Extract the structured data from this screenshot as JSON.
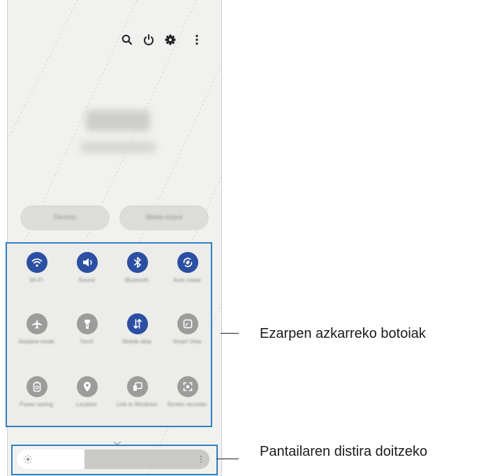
{
  "phone": {
    "top_icons": [
      "search-icon",
      "power-icon",
      "settings-icon",
      "more-vertical-icon"
    ],
    "quick_settings": [
      {
        "label": "Wi-Fi",
        "icon": "wifi-icon",
        "active": true
      },
      {
        "label": "Sound",
        "icon": "sound-icon",
        "active": true
      },
      {
        "label": "Bluetooth",
        "icon": "bluetooth-icon",
        "active": true
      },
      {
        "label": "Auto rotate",
        "icon": "auto-rotate-icon",
        "active": true
      },
      {
        "label": "Airplane mode",
        "icon": "airplane-icon",
        "active": false
      },
      {
        "label": "Torch",
        "icon": "flashlight-icon",
        "active": false
      },
      {
        "label": "Mobile data",
        "icon": "mobile-data-icon",
        "active": true
      },
      {
        "label": "Smart View",
        "icon": "cast-icon",
        "active": false
      },
      {
        "label": "Power saving",
        "icon": "power-saving-icon",
        "active": false
      },
      {
        "label": "Location",
        "icon": "location-icon",
        "active": false
      },
      {
        "label": "Link to Windows",
        "icon": "link-windows-icon",
        "active": false
      },
      {
        "label": "Screen recorder",
        "icon": "screen-recorder-icon",
        "active": false
      }
    ],
    "brightness": {
      "level": 0.35
    }
  },
  "callouts": {
    "quick_settings": "Ezarpen azkarreko botoiak",
    "brightness": "Pantailaren distira doitzeko"
  },
  "colors": {
    "accent": "#2f7fbe",
    "tile_active": "#2b4fa2",
    "tile_inactive": "#9c9c9a"
  }
}
